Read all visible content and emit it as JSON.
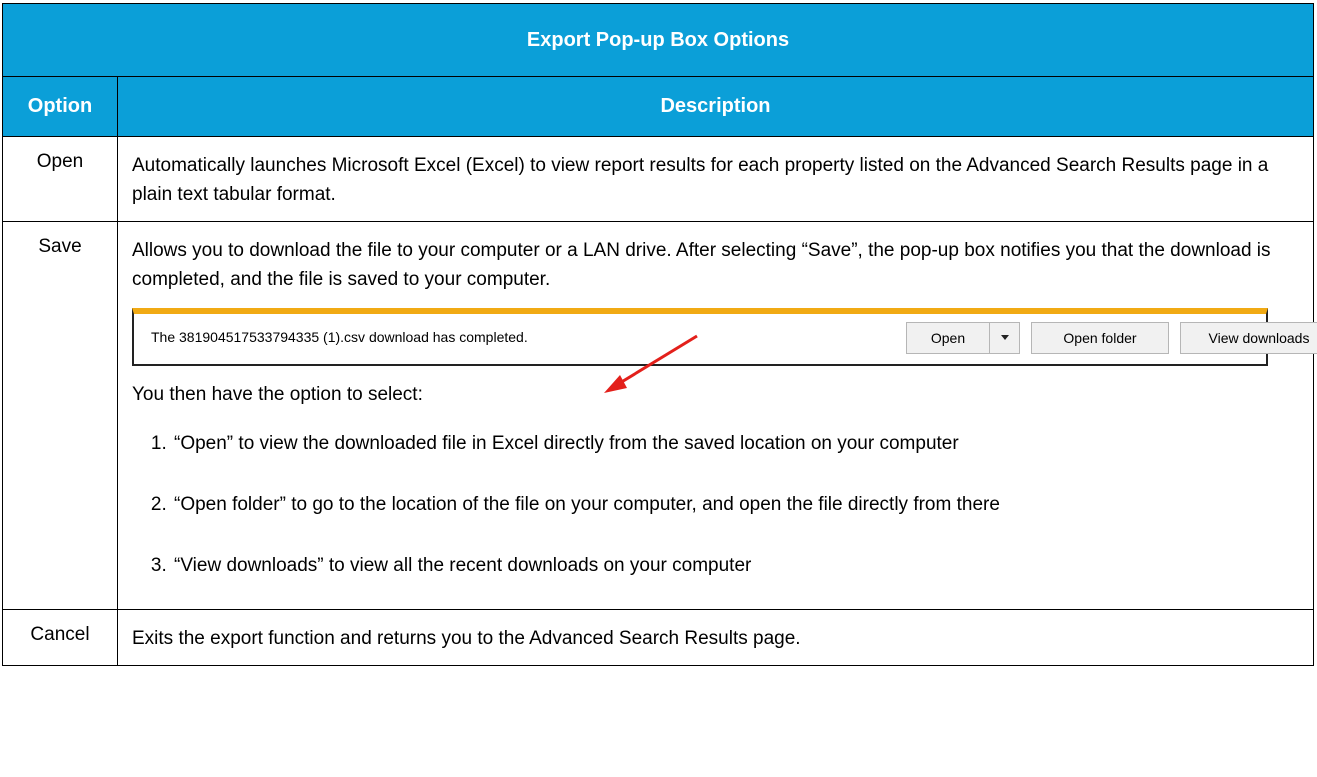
{
  "table": {
    "title": "Export Pop-up Box Options",
    "headers": {
      "option": "Option",
      "description": "Description"
    },
    "rows": {
      "open": {
        "option": "Open",
        "description": "Automatically launches Microsoft Excel (Excel) to view report results for each property listed on the Advanced Search Results page in a plain text tabular format."
      },
      "save": {
        "option": "Save",
        "description": "Allows you to download the file to your computer or a LAN drive. After selecting “Save”, the pop-up box notifies you that the download is completed, and the file is saved to your computer.",
        "then_text": "You then have the option to select:",
        "list": [
          "“Open” to view the downloaded file in Excel directly from the saved location on your computer",
          "“Open folder” to go to the location of the file on your computer, and open the file directly from there",
          "“View downloads” to view all the recent downloads on your computer"
        ]
      },
      "cancel": {
        "option": "Cancel",
        "description": "Exits the export function and returns you to the Advanced Search Results page."
      }
    }
  },
  "notification": {
    "message": "The 381904517533794335 (1).csv download has completed.",
    "open_button": "Open",
    "dropdown_icon": "chevron-down-icon",
    "open_folder_button": "Open folder",
    "view_downloads_button": "View downloads",
    "close_icon": "×",
    "accent_color": "#f1aa14"
  },
  "colors": {
    "header_bg": "#0b9fd8",
    "header_text": "#ffffff",
    "arrow": "#e3201b"
  }
}
